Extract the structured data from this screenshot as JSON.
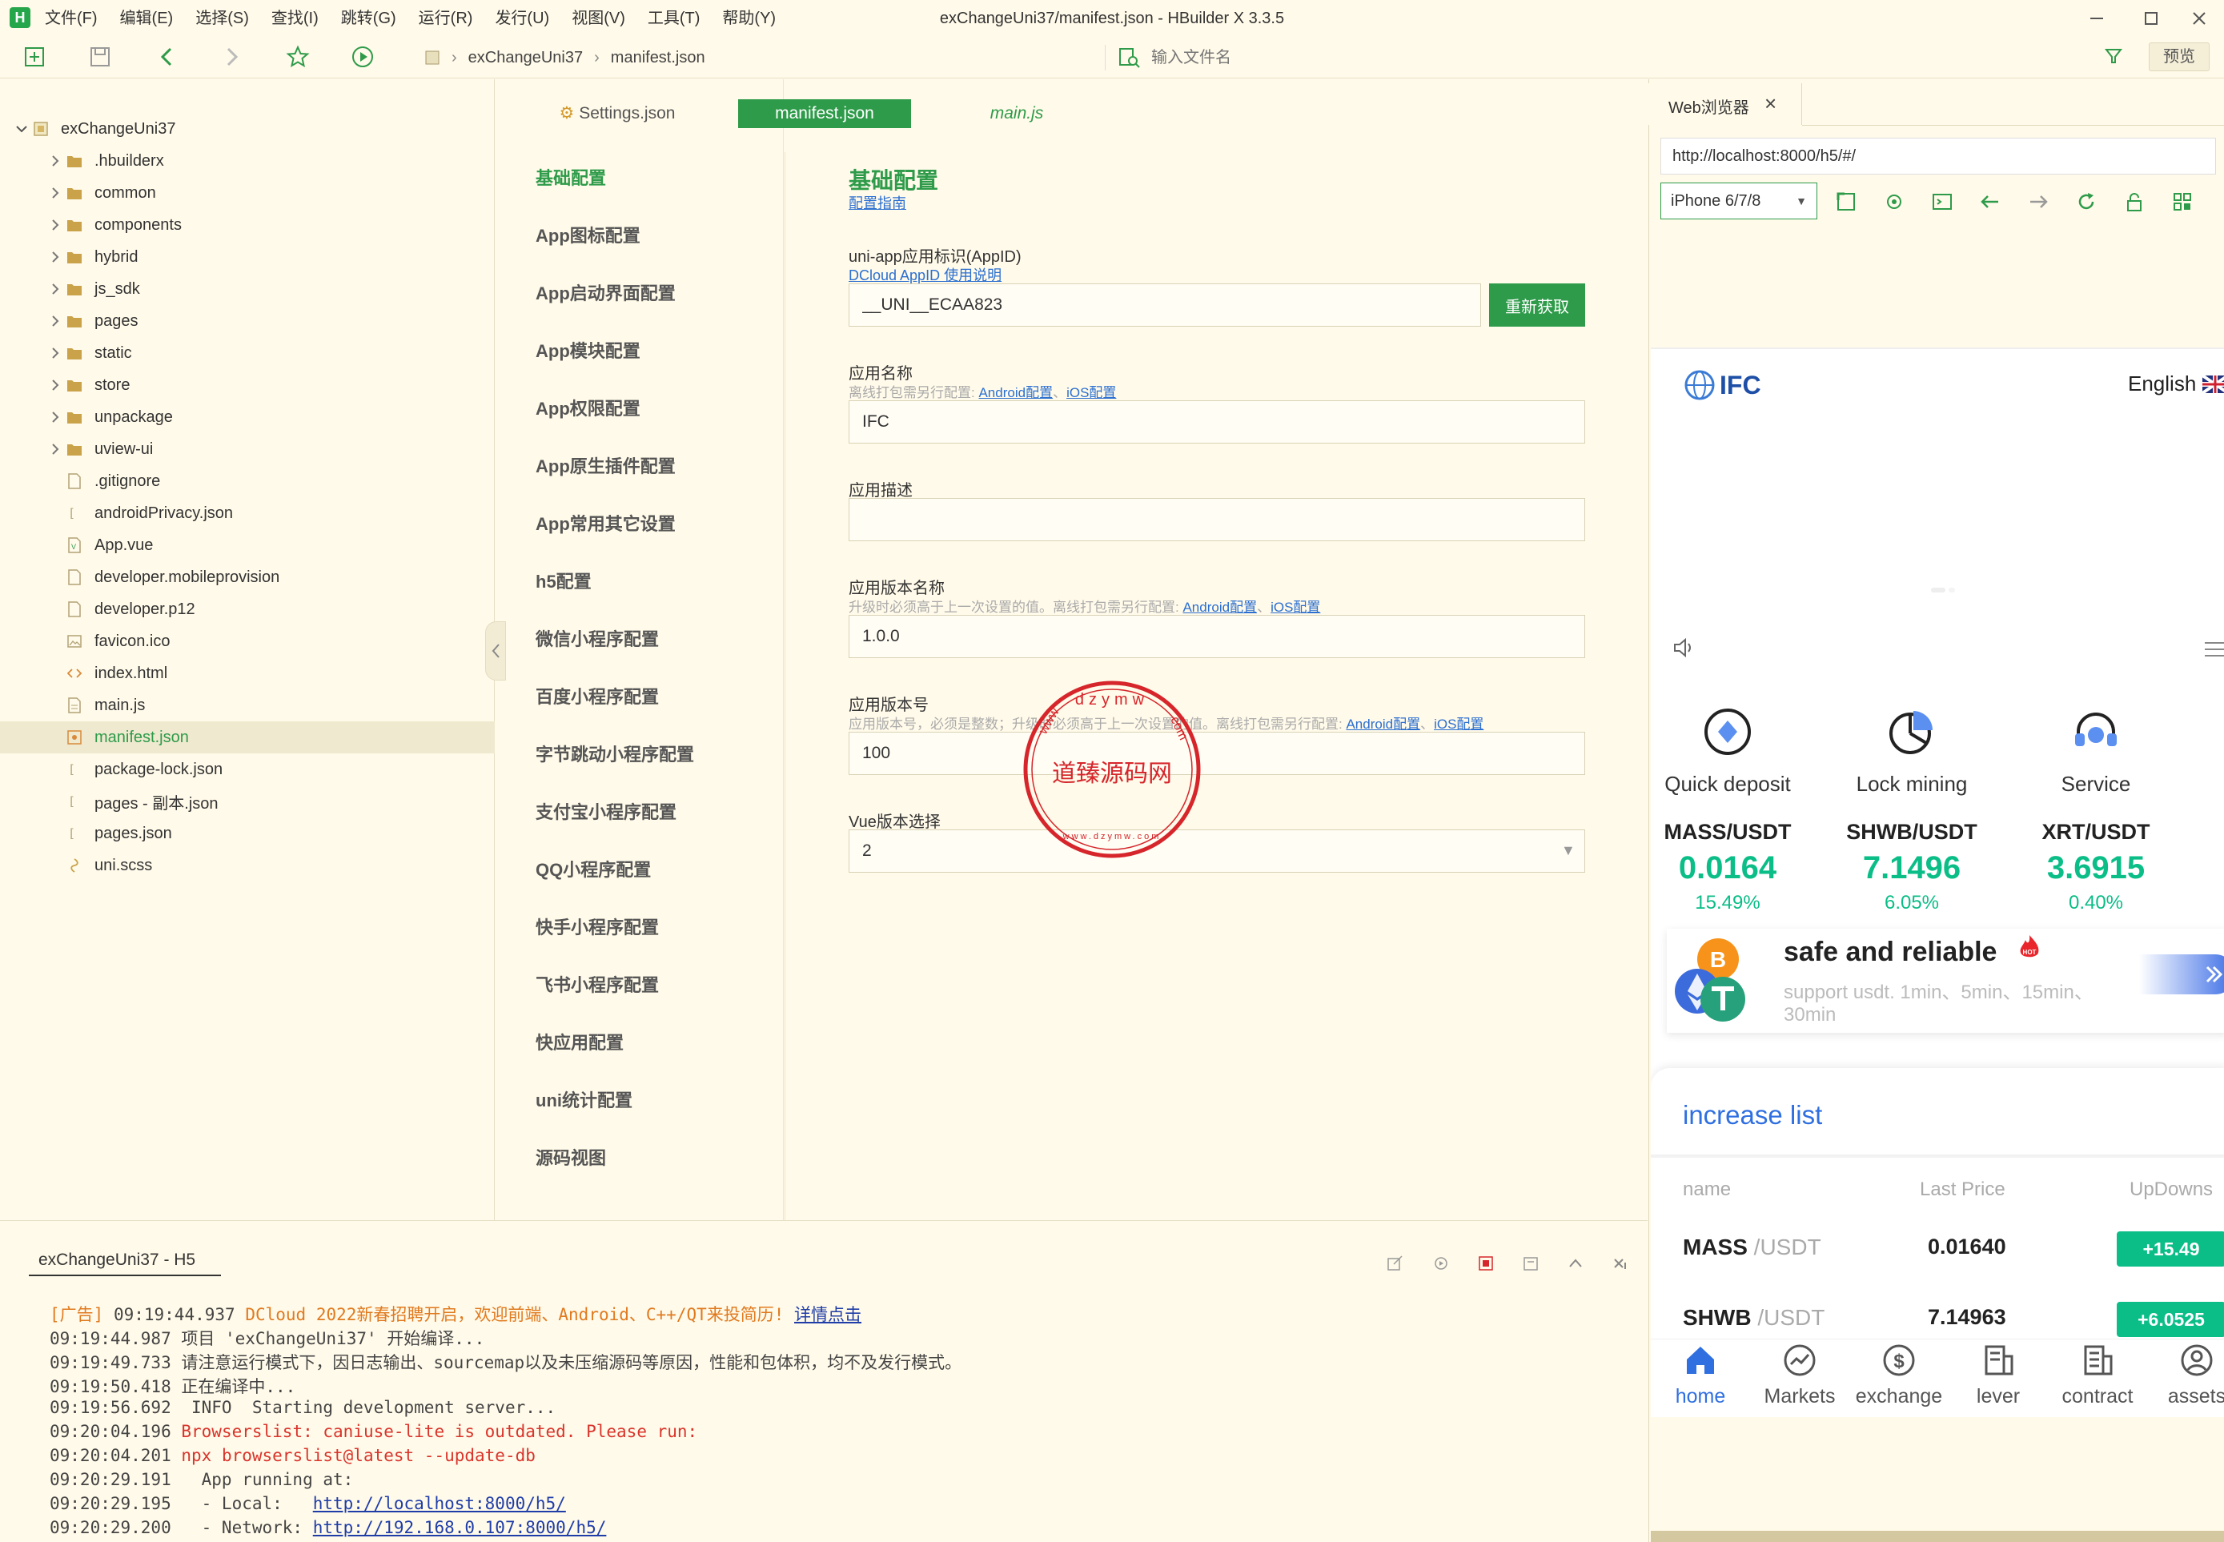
{
  "window": {
    "title": "exChangeUni37/manifest.json - HBuilder X 3.3.5",
    "menu": [
      "文件(F)",
      "编辑(E)",
      "选择(S)",
      "查找(I)",
      "跳转(G)",
      "运行(R)",
      "发行(U)",
      "视图(V)",
      "工具(T)",
      "帮助(Y)"
    ]
  },
  "toolbar": {
    "breadcrumb": [
      "exChangeUni37",
      "manifest.json"
    ],
    "file_search_placeholder": "输入文件名",
    "preview_label": "预览"
  },
  "tree": {
    "root": "exChangeUni37",
    "folders": [
      ".hbuilderx",
      "common",
      "components",
      "hybrid",
      "js_sdk",
      "pages",
      "static",
      "store",
      "unpackage",
      "uview-ui"
    ],
    "files": [
      {
        "name": ".gitignore",
        "icon": "file-icon"
      },
      {
        "name": "androidPrivacy.json",
        "icon": "json-icon"
      },
      {
        "name": "App.vue",
        "icon": "vue-icon"
      },
      {
        "name": "developer.mobileprovision",
        "icon": "file-icon"
      },
      {
        "name": "developer.p12",
        "icon": "file-icon"
      },
      {
        "name": "favicon.ico",
        "icon": "image-icon"
      },
      {
        "name": "index.html",
        "icon": "html-icon"
      },
      {
        "name": "main.js",
        "icon": "js-icon"
      },
      {
        "name": "manifest.json",
        "icon": "manifest-icon"
      },
      {
        "name": "package-lock.json",
        "icon": "json-icon"
      },
      {
        "name": "pages - 副本.json",
        "icon": "json-icon"
      },
      {
        "name": "pages.json",
        "icon": "json-icon"
      },
      {
        "name": "uni.scss",
        "icon": "scss-icon"
      }
    ],
    "selected": "manifest.json"
  },
  "tabs": [
    {
      "label": "Settings.json"
    },
    {
      "label": "manifest.json"
    },
    {
      "label": "main.js"
    }
  ],
  "settings_nav": [
    "基础配置",
    "App图标配置",
    "App启动界面配置",
    "App模块配置",
    "App权限配置",
    "App原生插件配置",
    "App常用其它设置",
    "h5配置",
    "微信小程序配置",
    "百度小程序配置",
    "字节跳动小程序配置",
    "支付宝小程序配置",
    "QQ小程序配置",
    "快手小程序配置",
    "飞书小程序配置",
    "快应用配置",
    "uni统计配置",
    "源码视图"
  ],
  "form": {
    "title": "基础配置",
    "guide_link": "配置指南",
    "appid_label": "uni-app应用标识(AppID)",
    "appid_link": "DCloud AppID 使用说明",
    "appid_value": "__UNI__ECAA823",
    "refresh_label": "重新获取",
    "name_label": "应用名称",
    "name_hint": "离线打包需另行配置:",
    "android_cfg": "Android配置",
    "ios_cfg": "iOS配置",
    "sep": "、",
    "name_value": "IFC",
    "desc_label": "应用描述",
    "desc_value": "",
    "vername_label": "应用版本名称",
    "vername_hint": "升级时必须高于上一次设置的值。离线打包需另行配置:",
    "vername_value": "1.0.0",
    "vercode_label": "应用版本号",
    "vercode_hint": "应用版本号，必须是整数；升级时必须高于上一次设置的值。离线打包需另行配置:",
    "vercode_value": "100",
    "vue_label": "Vue版本选择",
    "vue_value": "2"
  },
  "stamp": {
    "top_text": "dzymw",
    "www": "www",
    "com": "com",
    "center_text": "道臻源码网",
    "bottom_text": "www.dzymw.com"
  },
  "console": {
    "tab_label": "exChangeUni37 - H5",
    "lines": [
      {
        "parts": [
          {
            "t": "[广告] ",
            "c": "orange"
          },
          {
            "t": "09:19:44.937 ",
            "c": ""
          },
          {
            "t": "DCloud 2022新春招聘开启，欢迎前端、Android、C++/QT来投简历! ",
            "c": "orange"
          },
          {
            "t": "详情点击",
            "c": "link"
          }
        ]
      },
      {
        "parts": [
          {
            "t": "09:19:44.987 项目 'exChangeUni37' 开始编译...",
            "c": ""
          }
        ]
      },
      {
        "parts": [
          {
            "t": "09:19:49.733 请注意运行模式下，因日志输出、sourcemap以及未压缩源码等原因，性能和包体积，均不及发行模式。",
            "c": ""
          }
        ]
      },
      {
        "parts": [
          {
            "t": "09:19:50.418 正在编译中...",
            "c": ""
          }
        ]
      },
      {
        "parts": [
          {
            "t": "09:19:56.692  INFO  Starting development server...",
            "c": ""
          }
        ]
      },
      {
        "parts": [
          {
            "t": "09:20:04.196 ",
            "c": ""
          },
          {
            "t": "Browserslist: caniuse-lite is outdated. Please run:",
            "c": "red"
          }
        ]
      },
      {
        "parts": [
          {
            "t": "09:20:04.201 ",
            "c": ""
          },
          {
            "t": "npx browserslist@latest --update-db",
            "c": "red"
          }
        ]
      },
      {
        "parts": [
          {
            "t": "09:20:29.191   App running at:",
            "c": ""
          }
        ]
      },
      {
        "parts": [
          {
            "t": "09:20:29.195   - Local:   ",
            "c": ""
          },
          {
            "t": "http://localhost:8000/h5/",
            "c": "link"
          }
        ]
      },
      {
        "parts": [
          {
            "t": "09:20:29.200   - Network: ",
            "c": ""
          },
          {
            "t": "http://192.168.0.107:8000/h5/",
            "c": "link"
          }
        ]
      }
    ]
  },
  "browser": {
    "tab_label": "Web浏览器",
    "url": "http://localhost:8000/h5/#/",
    "device": "iPhone 6/7/8"
  },
  "phone": {
    "logo_text": "IFC",
    "language": "English",
    "quick": [
      {
        "label": "Quick deposit",
        "icon": "deposit-icon"
      },
      {
        "label": "Lock mining",
        "icon": "mining-pie-icon"
      },
      {
        "label": "Service",
        "icon": "headset-icon"
      }
    ],
    "tickers": [
      {
        "pair": "MASS/USDT",
        "price": "0.0164",
        "pct": "15.49%"
      },
      {
        "pair": "SHWB/USDT",
        "price": "7.1496",
        "pct": "6.05%"
      },
      {
        "pair": "XRT/USDT",
        "price": "3.6915",
        "pct": "0.40%"
      }
    ],
    "banner": {
      "title": "safe and reliable",
      "hot": "HOT",
      "coin_b": "B",
      "sub": "support usdt. 1min、5min、15min、30min"
    },
    "increase": {
      "title": "increase list",
      "cols": [
        "name",
        "Last Price",
        "UpDowns"
      ],
      "rows": [
        {
          "base": "MASS",
          "quote": " /USDT",
          "price": "0.01640",
          "change": "+15.49"
        },
        {
          "base": "SHWB",
          "quote": " /USDT",
          "price": "7.14963",
          "change": "+6.0525"
        }
      ]
    },
    "nav": [
      {
        "label": "home",
        "icon": "home-icon",
        "active": true
      },
      {
        "label": "Markets",
        "icon": "markets-icon",
        "active": false
      },
      {
        "label": "exchange",
        "icon": "exchange-icon",
        "active": false
      },
      {
        "label": "lever",
        "icon": "lever-icon",
        "active": false
      },
      {
        "label": "contract",
        "icon": "contract-icon",
        "active": false
      },
      {
        "label": "assets",
        "icon": "assets-icon",
        "active": false
      }
    ]
  },
  "colors": {
    "accent": "#2e9b4a",
    "up": "#0bbd87",
    "link": "#2b6fd1",
    "panel_bg": "#fffae9"
  }
}
